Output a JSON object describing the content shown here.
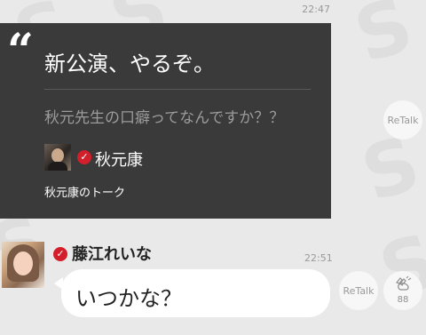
{
  "timestamps": {
    "quote": "22:47",
    "message": "22:51"
  },
  "quote": {
    "mark": "“",
    "title": "新公演、やるぞ。",
    "question": "秋元先生の口癖ってなんですか？？",
    "author": "秋元康",
    "talk_link": "秋元康のトーク"
  },
  "actions": {
    "retalk": "ReTalk",
    "clap_count": "88"
  },
  "message": {
    "sender": "藤江れいな",
    "text": "いつかな？"
  },
  "icons": {
    "verified": "check-badge-icon",
    "clap": "clapping-hands-icon"
  },
  "colors": {
    "background": "#e9e9e9",
    "card": "#3a3a3a",
    "verified": "#d21f2b",
    "bubble": "#ffffff"
  }
}
